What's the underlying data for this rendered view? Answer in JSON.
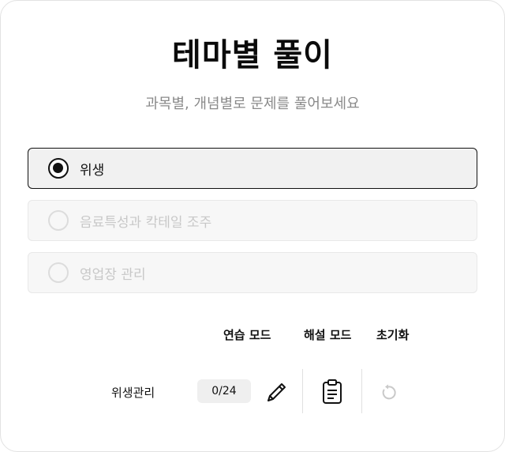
{
  "header": {
    "title": "테마별 풀이",
    "subtitle": "과목별, 개념별로 문제를 풀어보세요"
  },
  "subjects": [
    {
      "label": "위생",
      "selected": true,
      "enabled": true
    },
    {
      "label": "음료특성과 칵테일 조주",
      "selected": false,
      "enabled": false
    },
    {
      "label": "영업장 관리",
      "selected": false,
      "enabled": false
    }
  ],
  "columns": {
    "practice_mode": "연습 모드",
    "explanation_mode": "해설 모드",
    "reset": "초기화"
  },
  "rows": [
    {
      "label": "위생관리",
      "progress": "0/24"
    }
  ],
  "icons": {
    "practice": "pencil-icon",
    "explanation": "clipboard-icon",
    "reset": "refresh-icon"
  },
  "colors": {
    "selected_border": "#111111",
    "selected_bg": "#f1f1f1",
    "disabled_text": "#c8c8c8",
    "subtitle": "#8a8a8a"
  }
}
